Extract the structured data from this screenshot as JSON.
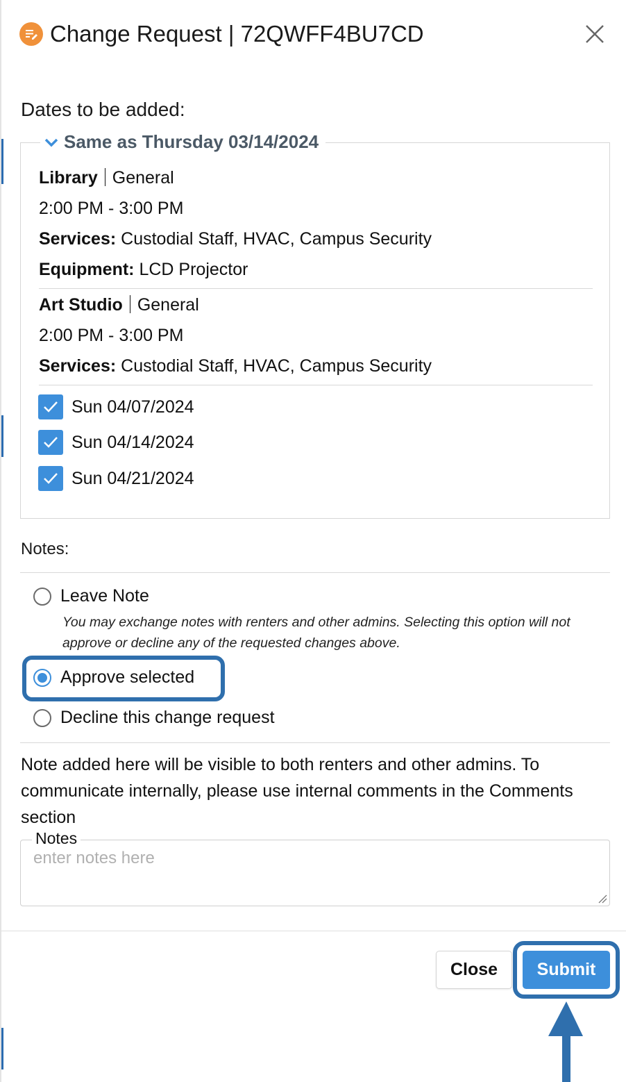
{
  "header": {
    "title": "Change Request | 72QWFF4BU7CD",
    "icon": "edit-note-icon",
    "icon_color": "#f0913a",
    "close_icon": "close-icon"
  },
  "dates_section": {
    "title": "Dates to be added:",
    "group_label": "Same as Thursday 03/14/2024",
    "items": [
      {
        "location": "Library",
        "category": "General",
        "time": "2:00 PM - 3:00 PM",
        "services_label": "Services:",
        "services": "Custodial Staff, HVAC, Campus Security",
        "equipment_label": "Equipment:",
        "equipment": "LCD Projector"
      },
      {
        "location": "Art Studio",
        "category": "General",
        "time": "2:00 PM - 3:00 PM",
        "services_label": "Services:",
        "services": "Custodial Staff, HVAC, Campus Security"
      }
    ],
    "dates": [
      {
        "label": "Sun 04/07/2024",
        "checked": true
      },
      {
        "label": "Sun 04/14/2024",
        "checked": true
      },
      {
        "label": "Sun 04/21/2024",
        "checked": true
      }
    ]
  },
  "notes_section": {
    "title": "Notes:",
    "options": [
      {
        "label": "Leave Note",
        "selected": false,
        "hint": "You may exchange notes with renters and other admins. Selecting this option will not approve or decline any of the requested changes above."
      },
      {
        "label": "Approve selected",
        "selected": true
      },
      {
        "label": "Decline this change request",
        "selected": false
      }
    ],
    "info": "Note added here will be visible to both renters and other admins. To communicate internally, please use internal comments in the Comments section",
    "notes_label": "Notes",
    "notes_placeholder": "enter notes here",
    "notes_value": ""
  },
  "footer": {
    "close_label": "Close",
    "submit_label": "Submit"
  },
  "colors": {
    "accent": "#3d8fdb",
    "highlight": "#2f6fad",
    "legend_text": "#4b5966"
  }
}
